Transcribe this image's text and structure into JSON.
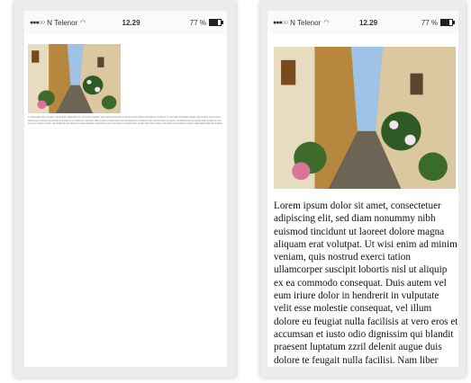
{
  "status_bar": {
    "signal": "●●●○○",
    "carrier": "N Telenor",
    "wifi_icon": "wifi-icon",
    "time": "12.29",
    "battery_percent": "77 %",
    "battery_level": 0.77
  },
  "article": {
    "image_icon": "street-photo",
    "body": "Lorem ipsum dolor sit amet, consectetuer adipiscing elit, sed diam nonummy nibh euismod tincidunt ut laoreet dolore magna aliquam erat volutpat. Ut wisi enim ad minim veniam, quis nostrud exerci tation ullamcorper suscipit lobortis nisl ut aliquip ex ea commodo consequat. Duis autem vel eum iriure dolor in hendrerit in vulputate velit esse molestie consequat, vel illum dolore eu feugiat nulla facilisis at vero eros et accumsan et iusto odio dignissim qui blandit praesent luptatum zzril delenit augue duis dolore te feugait nulla facilisi. Nam liber tempor cum soluta nobis eleifend option congue nihil imperdiet doming"
  }
}
